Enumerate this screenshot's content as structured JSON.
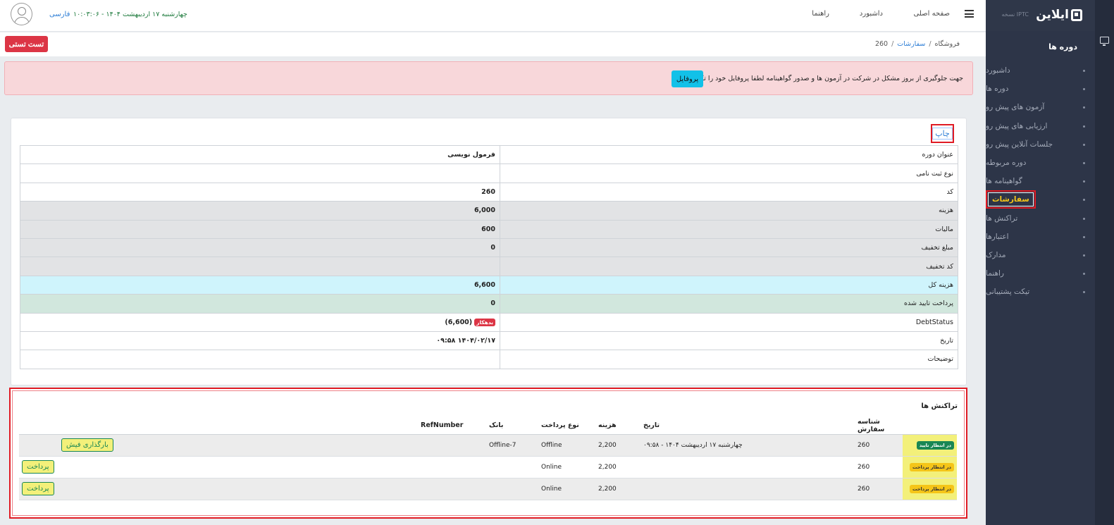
{
  "colors": {
    "sidebar": "#2d3548",
    "accent_red": "#dc3545",
    "info_cyan": "#12c1e8",
    "active_yellow": "#f5c518"
  },
  "sidebar": {
    "logo_text": "ایلاین",
    "version": "نسخه IPTC",
    "section_title": "دوره ها",
    "items": [
      {
        "label": "داشبورد",
        "icon": "bullet-icon"
      },
      {
        "label": "دوره ها",
        "icon": "bullet-icon"
      },
      {
        "label": "آزمون های پیش رو",
        "icon": "bullet-icon"
      },
      {
        "label": "ارزیابی های پیش رو",
        "icon": "bullet-icon"
      },
      {
        "label": "جلسات آنلاین پیش رو",
        "icon": "bullet-icon"
      },
      {
        "label": "دوره مربوطه",
        "icon": "bullet-icon"
      },
      {
        "label": "گواهینامه ها",
        "icon": "bullet-icon"
      },
      {
        "label": "سفارشات",
        "icon": "bullet-icon",
        "active": true
      },
      {
        "label": "تراکنش ها",
        "icon": "bullet-icon"
      },
      {
        "label": "اعتبارها",
        "icon": "bullet-icon"
      },
      {
        "label": "مدارک",
        "icon": "bullet-icon"
      },
      {
        "label": "راهنما",
        "icon": "bullet-icon"
      },
      {
        "label": "تیکت پشتیبانی",
        "icon": "bullet-icon"
      }
    ]
  },
  "header": {
    "nav": [
      "صفحه اصلی",
      "داشبورد",
      "راهنما"
    ],
    "language": "فارسی",
    "datetime": "چهارشنبه ۱۷ اردیبهشت ۱۴۰۴ - ۱۰:۰۳:۰۶"
  },
  "breadcrumb": {
    "shop": "فروشگاه",
    "orders": "سفارشات",
    "current": "260"
  },
  "test_button": "تست تستی",
  "alert": {
    "text": "جهت جلوگیری از بروز مشکل در شرکت در آزمون ها و صدور گواهینامه لطفا پروفایل خود را تکمیل نمایید",
    "button": "پروفایل"
  },
  "order": {
    "print_label": "چاپ",
    "rows": [
      {
        "key": "عنوان دوره",
        "value": "فرمول نویسی",
        "style": ""
      },
      {
        "key": "نوع ثبت نامی",
        "value": "",
        "style": ""
      },
      {
        "key": "کد",
        "value": "260",
        "style": ""
      },
      {
        "key": "هزینه",
        "value": "6,000",
        "style": "gray"
      },
      {
        "key": "مالیات",
        "value": "600",
        "style": "gray"
      },
      {
        "key": "مبلغ تخفیف",
        "value": "0",
        "style": "gray"
      },
      {
        "key": "کد تخفیف",
        "value": "",
        "style": "gray"
      },
      {
        "key": "هزینه کل",
        "value": "6,600",
        "style": "cyan"
      },
      {
        "key": "پرداخت تایید شده",
        "value": "0",
        "style": "green"
      },
      {
        "key": "DebtStatus",
        "value": "(6,600)",
        "badge": "بدهکار",
        "style": ""
      },
      {
        "key": "تاریخ",
        "value": "۱۴۰۴/۰۲/۱۷ ۰۹:۵۸",
        "style": ""
      },
      {
        "key": "توضیحات",
        "value": "",
        "style": ""
      }
    ]
  },
  "transactions": {
    "title": "تراکنش ها",
    "columns": [
      "",
      "شناسه سفارش",
      "تاریخ",
      "هزینه",
      "نوع پرداخت",
      "بانک",
      "RefNumber",
      "",
      ""
    ],
    "rows": [
      {
        "status": "در انتظار تایید",
        "status_type": "ok",
        "order_id": "260",
        "date": "چهارشنبه ۱۷ اردیبهشت ۱۴۰۴ - ۰۹:۵۸",
        "amount": "2,200",
        "pay_type": "Offline",
        "bank": "Offline-7",
        "ref": "",
        "upload": "بارگذاری فیش",
        "pay": ""
      },
      {
        "status": "در انتظار پرداخت",
        "status_type": "wait",
        "order_id": "260",
        "date": "",
        "amount": "2,200",
        "pay_type": "Online",
        "bank": "",
        "ref": "",
        "upload": "",
        "pay": "پرداخت"
      },
      {
        "status": "در انتظار پرداخت",
        "status_type": "wait",
        "order_id": "260",
        "date": "",
        "amount": "2,200",
        "pay_type": "Online",
        "bank": "",
        "ref": "",
        "upload": "",
        "pay": "پرداخت"
      }
    ]
  }
}
